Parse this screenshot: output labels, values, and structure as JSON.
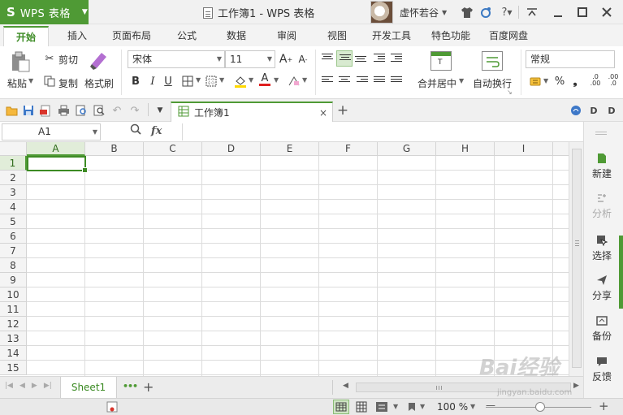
{
  "titlebar": {
    "app_logo": "S",
    "app_name": "WPS 表格",
    "doc_title": "工作簿1 - WPS 表格",
    "user_name": "虚怀若谷",
    "icons": [
      "shirt-icon",
      "skin-icon",
      "help-icon",
      "collapse-icon",
      "minimize-icon",
      "maximize-icon",
      "close-icon"
    ],
    "help_label": "?"
  },
  "tabs": [
    {
      "label": "开始",
      "active": true
    },
    {
      "label": "插入"
    },
    {
      "label": "页面布局"
    },
    {
      "label": "公式"
    },
    {
      "label": "数据"
    },
    {
      "label": "审阅"
    },
    {
      "label": "视图"
    },
    {
      "label": "开发工具"
    },
    {
      "label": "特色功能"
    },
    {
      "label": "百度网盘"
    }
  ],
  "ribbon": {
    "paste_label": "粘贴",
    "cut_label": "剪切",
    "copy_label": "复制",
    "format_painter_label": "格式刷",
    "font_name": "宋体",
    "font_size": "11",
    "bold": "B",
    "italic": "I",
    "underline": "U",
    "font_color_label": "A",
    "merge_label": "合并居中",
    "wrap_label": "自动换行",
    "number_format": "常规",
    "percent_label": "%",
    "comma_label": "❟"
  },
  "docbar": {
    "doc_tab_label": "工作簿1",
    "close_tab": "×",
    "new_tab": "+"
  },
  "formula": {
    "name_box": "A1",
    "fx_label": "fx",
    "content": ""
  },
  "grid": {
    "columns": [
      "A",
      "B",
      "C",
      "D",
      "E",
      "F",
      "G",
      "H",
      "I"
    ],
    "rows": [
      "1",
      "2",
      "3",
      "4",
      "5",
      "6",
      "7",
      "8",
      "9",
      "10",
      "11",
      "12",
      "13",
      "14",
      "15"
    ],
    "active_cell": "A1"
  },
  "sidepanel": {
    "items": [
      {
        "label": "新建",
        "icon": "new-doc-icon",
        "enabled": true
      },
      {
        "label": "分析",
        "icon": "analyze-icon",
        "enabled": false
      },
      {
        "label": "选择",
        "icon": "select-icon",
        "enabled": true
      },
      {
        "label": "分享",
        "icon": "share-icon",
        "enabled": true
      },
      {
        "label": "备份",
        "icon": "backup-icon",
        "enabled": true
      },
      {
        "label": "反馈",
        "icon": "feedback-icon",
        "enabled": true
      }
    ]
  },
  "sheets": {
    "active_sheet": "Sheet1",
    "more": "•••",
    "add": "+"
  },
  "statusbar": {
    "zoom": "100 %",
    "zoom_out": "—",
    "zoom_in": "+"
  },
  "watermark": {
    "brand": "Bai经验",
    "url": "jingyan.baidu.com"
  },
  "colors": {
    "accent": "#4f9a35",
    "selection_header": "#e1edd9"
  }
}
